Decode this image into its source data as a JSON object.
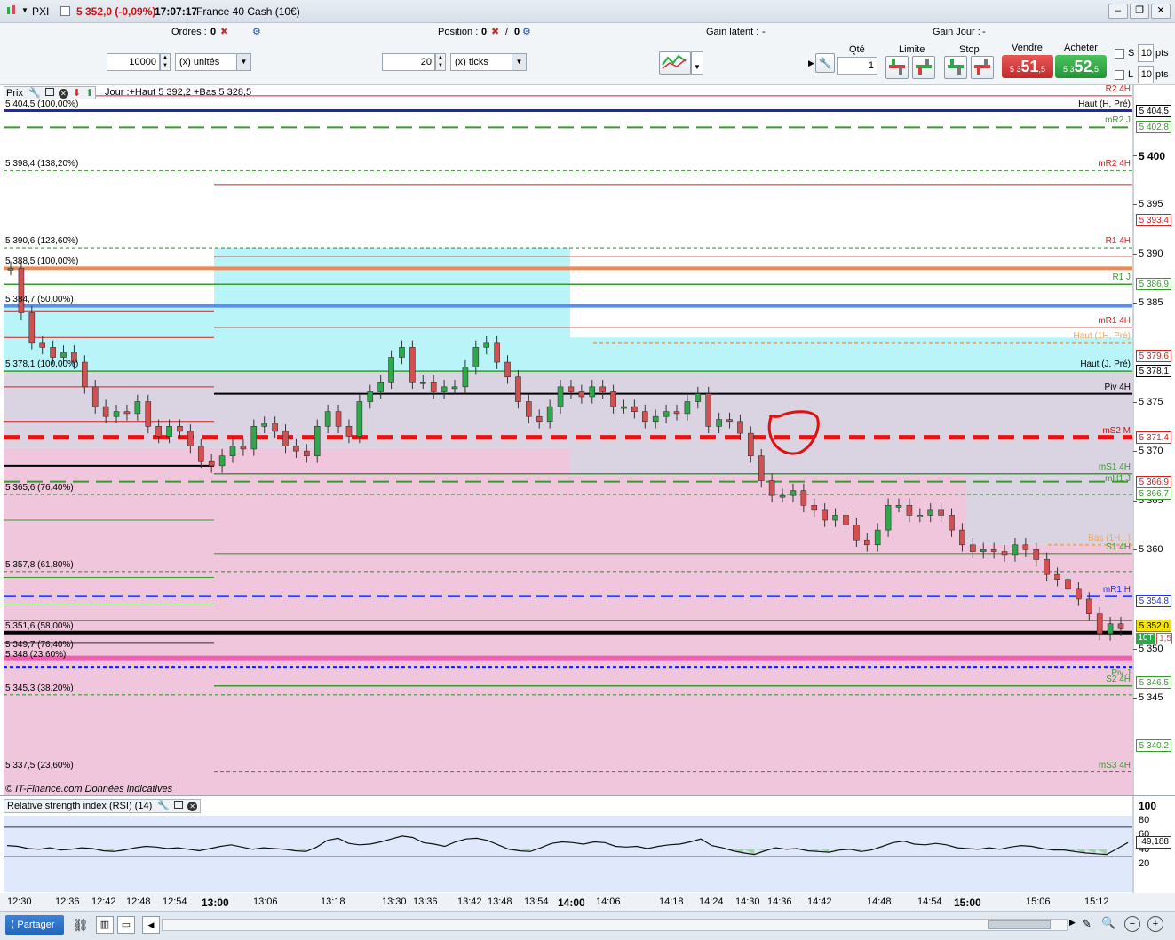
{
  "title": {
    "symbol": "PXI",
    "price_change": "5 352,0 (-0,09%)",
    "time": "17:07:17",
    "instrument": "France 40 Cash (10€)"
  },
  "orders_bar": {
    "orders_label": "Ordres :",
    "orders_value": "0",
    "position_label": "Position :",
    "position_value": "0",
    "position_sep": "/",
    "position_value2": "0",
    "gain_latent_label": "Gain latent :",
    "gain_latent_value": "-",
    "gain_jour_label": "Gain Jour :",
    "gain_jour_value": "-",
    "qty_value": "10000",
    "qty_unit": "(x) unités",
    "ticks_value": "20",
    "ticks_unit": "(x) ticks",
    "qte_label": "Qté",
    "qte_value": "1",
    "limite_label": "Limite",
    "stop_label": "Stop",
    "vendre_label": "Vendre",
    "acheter_label": "Acheter",
    "sell_prefix": "5 3",
    "sell_main": "51",
    "sell_suffix": ",5",
    "buy_prefix": "5 3",
    "buy_main": "52",
    "buy_suffix": ",5",
    "s_label": "S",
    "l_label": "L",
    "s_pts": "10",
    "l_pts": "10",
    "pts_label": "pts"
  },
  "chart_header": {
    "prix_label": "Prix",
    "info": "Jour :+Haut 5 392,2 +Bas 5 328,5"
  },
  "fib_labels": [
    {
      "text": "5 404,5 (100,00%)",
      "price": 5404.5
    },
    {
      "text": "5 398,4 (138,20%)",
      "price": 5398.4
    },
    {
      "text": "5 390,6 (123,60%)",
      "price": 5390.6
    },
    {
      "text": "5 388,5 (100,00%)",
      "price": 5388.5
    },
    {
      "text": "5 384,7 (50,00%)",
      "price": 5384.7
    },
    {
      "text": "5 378,1 (100,00%)",
      "price": 5378.1
    },
    {
      "text": "5 365,6 (76,40%)",
      "price": 5365.6
    },
    {
      "text": "5 357,8 (61,80%)",
      "price": 5357.8
    },
    {
      "text": "5 351,6 (58,00%)",
      "price": 5351.6
    },
    {
      "text": "5 349,7 (76,40%)",
      "price": 5349.7
    },
    {
      "text": "5 348 (23,60%)",
      "price": 5348.7
    },
    {
      "text": "5 345,3 (38,20%)",
      "price": 5345.3
    },
    {
      "text": "5 337,5 (23,60%)",
      "price": 5337.5
    }
  ],
  "level_labels": [
    {
      "text": "R2 4H",
      "price": 5406.0,
      "color": "#d32020"
    },
    {
      "text": "Haut (H, Pré)",
      "price": 5404.5,
      "color": "#000000"
    },
    {
      "text": "mR2 J",
      "price": 5402.8,
      "color": "#3a9a30"
    },
    {
      "text": "mR2 4H",
      "price": 5398.4,
      "color": "#d32020"
    },
    {
      "text": "R1 4H",
      "price": 5390.6,
      "color": "#d32020"
    },
    {
      "text": "R1 J",
      "price": 5386.9,
      "color": "#3a9a30"
    },
    {
      "text": "mR1 4H",
      "price": 5382.5,
      "color": "#d32020"
    },
    {
      "text": "Haut (1H, Pré)",
      "price": 5381.0,
      "color": "#f0a868"
    },
    {
      "text": "Haut (J, Pré)",
      "price": 5378.1,
      "color": "#000000"
    },
    {
      "text": "Piv 4H",
      "price": 5375.8,
      "color": "#000000"
    },
    {
      "text": "mS2 M",
      "price": 5371.4,
      "color": "#e01010"
    },
    {
      "text": "mS1 4H",
      "price": 5367.7,
      "color": "#3a9a30"
    },
    {
      "text": "mH1 J",
      "price": 5366.5,
      "color": "#3a9a30"
    },
    {
      "text": "Bas (1H...)",
      "price": 5360.5,
      "color": "#f0a868"
    },
    {
      "text": "S1 4H",
      "price": 5359.6,
      "color": "#3a9a30"
    },
    {
      "text": "mR1 H",
      "price": 5355.3,
      "color": "#2030e0"
    },
    {
      "text": "Piv J",
      "price": 5346.8,
      "color": "#3a9a30"
    },
    {
      "text": "S2 4H",
      "price": 5346.2,
      "color": "#3a9a30"
    },
    {
      "text": "mS3 4H",
      "price": 5337.5,
      "color": "#3a9a30"
    }
  ],
  "axis_ticks": [
    "5 400",
    "5 395",
    "5 390",
    "5 385",
    "5 375",
    "5 370",
    "5 365",
    "5 360",
    "5 350",
    "5 345"
  ],
  "axis_tick_values": [
    5400,
    5395,
    5390,
    5385,
    5375,
    5370,
    5365,
    5360,
    5350,
    5345
  ],
  "axis_boxes": [
    {
      "text": "5 404,5",
      "price": 5404.5,
      "bg": "#ffffff",
      "fg": "#000000"
    },
    {
      "text": "5 402,8",
      "price": 5402.8,
      "bg": "#ffffff",
      "fg": "#3a9a30"
    },
    {
      "text": "5 393,4",
      "price": 5393.4,
      "bg": "#ffffff",
      "fg": "#d32020"
    },
    {
      "text": "5 386,9",
      "price": 5386.9,
      "bg": "#ffffff",
      "fg": "#3a9a30"
    },
    {
      "text": "5 379,6",
      "price": 5379.6,
      "bg": "#ffffff",
      "fg": "#d32020"
    },
    {
      "text": "5 378,1",
      "price": 5378.1,
      "bg": "#ffffff",
      "fg": "#000000"
    },
    {
      "text": "5 371,4",
      "price": 5371.4,
      "bg": "#ffffff",
      "fg": "#d32020"
    },
    {
      "text": "5 366,9",
      "price": 5366.9,
      "bg": "#ffffff",
      "fg": "#d32020"
    },
    {
      "text": "5 366,7",
      "price": 5365.7,
      "bg": "#ffffff",
      "fg": "#3a9a30"
    },
    {
      "text": "5 354,8",
      "price": 5354.8,
      "bg": "#ffffff",
      "fg": "#2030e0"
    },
    {
      "text": "5 352,0",
      "price": 5352.3,
      "bg": "#f4e400",
      "fg": "#000000"
    },
    {
      "text": "5 340,2",
      "price": 5340.2,
      "bg": "#ffffff",
      "fg": "#3a9a30"
    },
    {
      "text": "5 346,5",
      "price": 5346.5,
      "bg": "#ffffff",
      "fg": "#3a9a30"
    }
  ],
  "axis_10t": "10T",
  "axis_partial": "1,5",
  "watermark": "© IT-Finance.com  Données indicatives",
  "rsi": {
    "title": "Relative strength index (RSI) (14)",
    "ticks": [
      "100",
      "80",
      "60",
      "40",
      "20"
    ],
    "tick_values": [
      100,
      80,
      60,
      40,
      20
    ],
    "value_box": "49,188",
    "level_box": "60"
  },
  "time_axis": [
    {
      "t": "12:30",
      "bold": false
    },
    {
      "t": "12:36",
      "bold": false
    },
    {
      "t": "12:42",
      "bold": false
    },
    {
      "t": "12:48",
      "bold": false
    },
    {
      "t": "12:54",
      "bold": false
    },
    {
      "t": "13:00",
      "bold": true
    },
    {
      "t": "13:06",
      "bold": false
    },
    {
      "t": "13:18",
      "bold": false
    },
    {
      "t": "13:30",
      "bold": false
    },
    {
      "t": "13:36",
      "bold": false
    },
    {
      "t": "13:42",
      "bold": false
    },
    {
      "t": "13:48",
      "bold": false
    },
    {
      "t": "13:54",
      "bold": false
    },
    {
      "t": "14:00",
      "bold": true
    },
    {
      "t": "14:06",
      "bold": false
    },
    {
      "t": "14:18",
      "bold": false
    },
    {
      "t": "14:24",
      "bold": false
    },
    {
      "t": "14:30",
      "bold": false
    },
    {
      "t": "14:36",
      "bold": false
    },
    {
      "t": "14:42",
      "bold": false
    },
    {
      "t": "14:48",
      "bold": false
    },
    {
      "t": "14:54",
      "bold": false
    },
    {
      "t": "15:00",
      "bold": true
    },
    {
      "t": "15:06",
      "bold": false
    },
    {
      "t": "15:12",
      "bold": false
    }
  ],
  "bottom": {
    "share_label": "Partager"
  },
  "chart_data": {
    "type": "candlestick",
    "ylim": [
      5332,
      5408
    ],
    "close_path": [
      5388.5,
      5384.0,
      5381.0,
      5380.5,
      5379.5,
      5380.0,
      5379.0,
      5376.5,
      5374.5,
      5373.5,
      5374.0,
      5373.8,
      5375.0,
      5372.5,
      5371.5,
      5372.5,
      5372.0,
      5370.5,
      5369.0,
      5368.5,
      5369.5,
      5370.5,
      5370.2,
      5372.5,
      5372.8,
      5372.0,
      5370.5,
      5370.0,
      5369.5,
      5372.5,
      5374.0,
      5372.5,
      5371.5,
      5375.0,
      5376.0,
      5377.0,
      5379.5,
      5380.5,
      5377.0,
      5377.0,
      5376.0,
      5376.5,
      5376.5,
      5378.5,
      5380.5,
      5381.0,
      5379.0,
      5377.5,
      5375.0,
      5373.5,
      5373.0,
      5374.5,
      5376.5,
      5376.0,
      5375.5,
      5376.5,
      5376.0,
      5374.5,
      5374.5,
      5374.0,
      5373.0,
      5373.5,
      5374.0,
      5373.8,
      5375.0,
      5375.8,
      5372.5,
      5373.2,
      5373.0,
      5371.8,
      5369.5,
      5367.0,
      5365.5,
      5365.5,
      5366.0,
      5364.5,
      5364.0,
      5363.0,
      5363.5,
      5362.5,
      5361.0,
      5360.5,
      5362.0,
      5364.5,
      5364.5,
      5363.5,
      5363.5,
      5364.0,
      5363.5,
      5362.0,
      5360.5,
      5359.8,
      5360.0,
      5359.8,
      5359.5,
      5360.5,
      5360.0,
      5359.0,
      5357.5,
      5357.0,
      5356.0,
      5355.0,
      5353.5,
      5351.5,
      5352.5,
      5352.0
    ],
    "rsi": [
      45,
      44,
      41,
      40,
      42,
      39,
      40,
      42,
      41,
      38,
      37,
      39,
      42,
      44,
      43,
      41,
      42,
      40,
      38,
      41,
      44,
      46,
      43,
      40,
      42,
      41,
      40,
      38,
      37,
      43,
      52,
      55,
      48,
      46,
      47,
      50,
      54,
      58,
      56,
      49,
      47,
      44,
      50,
      54,
      55,
      52,
      46,
      40,
      38,
      37,
      42,
      48,
      50,
      49,
      47,
      50,
      49,
      44,
      43,
      44,
      41,
      44,
      46,
      47,
      50,
      54,
      45,
      42,
      38,
      35,
      33,
      38,
      42,
      40,
      41,
      38,
      37,
      36,
      39,
      40,
      37,
      39,
      44,
      49,
      51,
      47,
      46,
      48,
      46,
      42,
      41,
      40,
      42,
      40,
      43,
      45,
      44,
      41,
      39,
      39,
      37,
      35,
      34,
      33,
      41,
      49
    ],
    "time_ticks": [
      "12:30",
      "12:36",
      "12:42",
      "12:48",
      "12:54",
      "13:00",
      "13:06",
      "13:18",
      "13:30",
      "13:36",
      "13:42",
      "13:48",
      "13:54",
      "14:00",
      "14:06",
      "14:18",
      "14:24",
      "14:30",
      "14:36",
      "14:42",
      "14:48",
      "14:54",
      "15:00",
      "15:06",
      "15:12"
    ],
    "price_ticks": [
      5400,
      5395,
      5390,
      5385,
      5375,
      5370,
      5365,
      5360,
      5350,
      5345
    ],
    "last_price": 5352.0,
    "rsi_last": 49.188
  },
  "colors": {
    "up": "#2ea84a",
    "down": "#d45050",
    "cyan_zone": "#b8f4f8",
    "pink_zone": "#f0c6dc",
    "grey_zone": "#d9d3e2",
    "mS2_dash": "#ee1111"
  }
}
